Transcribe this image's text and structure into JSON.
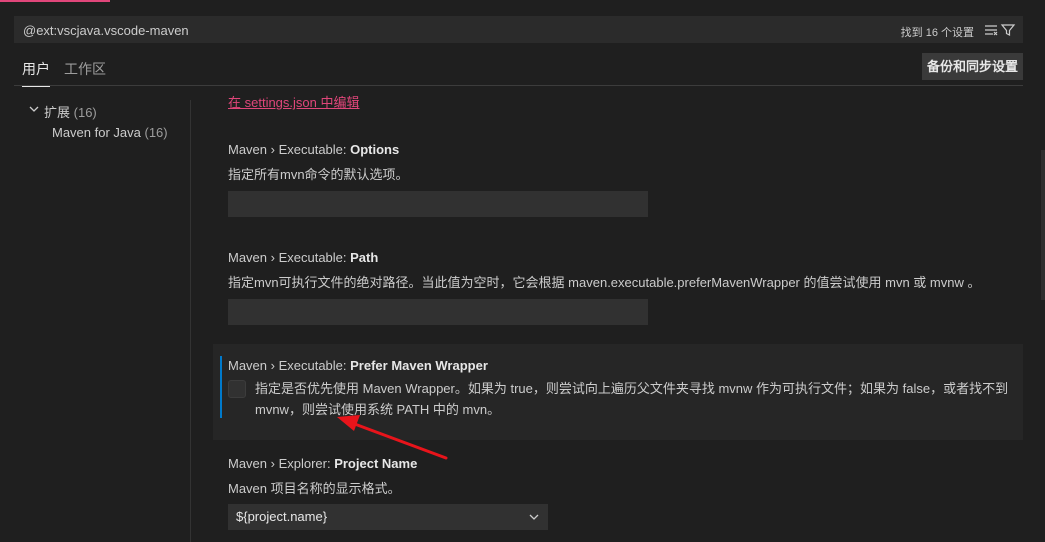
{
  "search": {
    "query": "@ext:vscjava.vscode-maven",
    "result_count": "找到 16 个设置"
  },
  "tabs": [
    {
      "label": "用户",
      "active": true
    },
    {
      "label": "工作区",
      "active": false
    }
  ],
  "sync_button_label": "备份和同步设置",
  "toc": {
    "group_label": "扩展",
    "group_count": "(16)",
    "item_label": "Maven for Java",
    "item_count": "(16)"
  },
  "edit_link": "在 settings.json 中编辑",
  "settings": [
    {
      "prefix": "Maven › Executable: ",
      "key": "Options",
      "description": "指定所有mvn命令的默认选项。",
      "value": ""
    },
    {
      "prefix": "Maven › Executable: ",
      "key": "Path",
      "description": "指定mvn可执行文件的绝对路径。当此值为空时，它会根据 maven.executable.preferMavenWrapper 的值尝试使用 mvn 或 mvnw 。",
      "value": ""
    },
    {
      "prefix": "Maven › Executable: ",
      "key": "Prefer Maven Wrapper",
      "description": "指定是否优先使用 Maven Wrapper。如果为 true，则尝试向上遍历父文件夹寻找 mvnw 作为可执行文件；如果为 false，或者找不到 mvnw，则尝试使用系统 PATH 中的 mvn。",
      "checked": false
    },
    {
      "prefix": "Maven › Explorer: ",
      "key": "Project Name",
      "description": "Maven 项目名称的显示格式。",
      "value": "${project.name}"
    }
  ],
  "colors": {
    "accent_link": "#e0467a",
    "focus_indicator": "#007acc",
    "annotation_arrow": "#e8141b"
  }
}
